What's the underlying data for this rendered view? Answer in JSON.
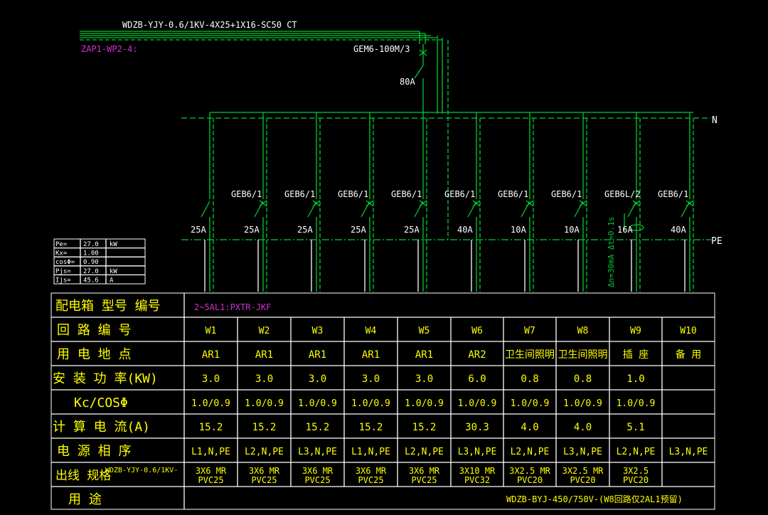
{
  "colors": {
    "background": "#000000",
    "wire_green": "#00cc33",
    "label_white": "#ffffff",
    "feeder_magenta": "#cc33cc",
    "table_yellow": "#ffff00",
    "table_line": "#ffffff"
  },
  "header": {
    "incoming_cable": "WDZB-YJY-0.6/1KV-4X25+1X16-SC50 CT",
    "feeder_id": "ZAP1-WP2-4:",
    "main_breaker": "GEM6-100M/3",
    "main_rating": "80A",
    "neutral_label": "N",
    "pe_label": "PE"
  },
  "branches": [
    {
      "breaker": "",
      "rating": "25A"
    },
    {
      "breaker": "GEB6/1",
      "rating": "25A"
    },
    {
      "breaker": "GEB6/1",
      "rating": "25A"
    },
    {
      "breaker": "GEB6/1",
      "rating": "25A"
    },
    {
      "breaker": "GEB6/1",
      "rating": "25A"
    },
    {
      "breaker": "GEB6/1",
      "rating": "40A"
    },
    {
      "breaker": "GEB6/1",
      "rating": "10A"
    },
    {
      "breaker": "GEB6/1",
      "rating": "10A"
    },
    {
      "breaker": "GEB6L/2",
      "rating": "16A",
      "rcd": "Δn=30mA  Δt=0.1s"
    },
    {
      "breaker": "GEB6/1",
      "rating": "40A"
    }
  ],
  "load_calc": {
    "rows": [
      {
        "label": "Pe=",
        "value": "27.0",
        "unit": "kW"
      },
      {
        "label": "Kx=",
        "value": "1.00",
        "unit": ""
      },
      {
        "label": "cosΦ=",
        "value": "0.90",
        "unit": ""
      },
      {
        "label": "Pjs=",
        "value": "27.0",
        "unit": "kW"
      },
      {
        "label": "Ijs=",
        "value": "45.6",
        "unit": "A"
      }
    ]
  },
  "table": {
    "box_label": "配电箱 型号 编号",
    "box_value": "2~5AL1:PXTR-JKF",
    "row_labels": [
      "回 路 编 号",
      "用 电 地 点",
      "安 装 功 率(KW)",
      "Kc/COSΦ",
      "计 算 电 流(A)",
      "电 源 相 序",
      "出线 规格",
      "用 途"
    ],
    "spec_cable": "WDZB-YJY-0.6/1KV-",
    "usage_note": "WDZB-BYJ-450/750V-(W8回路仅2AL1预留)",
    "circuits": [
      {
        "id": "W1",
        "location": "AR1",
        "power": "3.0",
        "kc": "1.0/0.9",
        "current": "15.2",
        "phase": "L1,N,PE",
        "spec1": "3X6 MR",
        "spec2": "PVC25"
      },
      {
        "id": "W2",
        "location": "AR1",
        "power": "3.0",
        "kc": "1.0/0.9",
        "current": "15.2",
        "phase": "L2,N,PE",
        "spec1": "3X6 MR",
        "spec2": "PVC25"
      },
      {
        "id": "W3",
        "location": "AR1",
        "power": "3.0",
        "kc": "1.0/0.9",
        "current": "15.2",
        "phase": "L3,N,PE",
        "spec1": "3X6 MR",
        "spec2": "PVC25"
      },
      {
        "id": "W4",
        "location": "AR1",
        "power": "3.0",
        "kc": "1.0/0.9",
        "current": "15.2",
        "phase": "L1,N,PE",
        "spec1": "3X6 MR",
        "spec2": "PVC25"
      },
      {
        "id": "W5",
        "location": "AR1",
        "power": "3.0",
        "kc": "1.0/0.9",
        "current": "15.2",
        "phase": "L2,N,PE",
        "spec1": "3X6 MR",
        "spec2": "PVC25"
      },
      {
        "id": "W6",
        "location": "AR2",
        "power": "6.0",
        "kc": "1.0/0.9",
        "current": "30.3",
        "phase": "L3,N,PE",
        "spec1": "3X10 MR",
        "spec2": "PVC32"
      },
      {
        "id": "W7",
        "location": "卫生间照明",
        "power": "0.8",
        "kc": "1.0/0.9",
        "current": "4.0",
        "phase": "L2,N,PE",
        "spec1": "3X2.5 MR",
        "spec2": "PVC20"
      },
      {
        "id": "W8",
        "location": "卫生间照明",
        "power": "0.8",
        "kc": "1.0/0.9",
        "current": "4.0",
        "phase": "L3,N,PE",
        "spec1": "3X2.5 MR",
        "spec2": "PVC20"
      },
      {
        "id": "W9",
        "location": "插 座",
        "power": "1.0",
        "kc": "1.0/0.9",
        "current": "5.1",
        "phase": "L2,N,PE",
        "spec1": "3X2.5",
        "spec2": "PVC20"
      },
      {
        "id": "W10",
        "location": "备 用",
        "power": "",
        "kc": "",
        "current": "",
        "phase": "L3,N,PE",
        "spec1": "",
        "spec2": ""
      }
    ]
  }
}
